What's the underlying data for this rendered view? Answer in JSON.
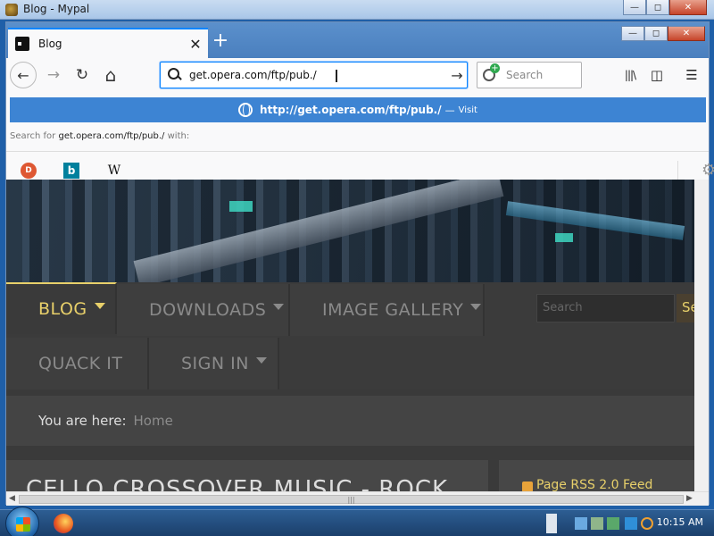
{
  "window": {
    "title": "Blog - Mypal",
    "minimize": "—",
    "maximize": "◻",
    "close": "✕"
  },
  "tab": {
    "title": "Blog",
    "close": "✕",
    "new": "+"
  },
  "nav": {
    "back": "←",
    "forward": "→",
    "reload": "↻",
    "home": "⌂",
    "url": "get.opera.com/ftp/pub./",
    "go": "→",
    "search_placeholder": "Search",
    "library": "|||\\",
    "sidebar": "◫",
    "menu": "☰"
  },
  "dropdown": {
    "suggest_url": "http://get.opera.com/ftp/pub./",
    "suggest_sep": "—",
    "suggest_action": "Visit",
    "search_for_prefix": "Search for",
    "search_for_query": "get.opera.com/ftp/pub./",
    "search_for_suffix": "with:",
    "engines": [
      {
        "name": "duckduckgo-icon",
        "glyph": "D"
      },
      {
        "name": "bing-icon",
        "glyph": "b"
      },
      {
        "name": "wikipedia-icon",
        "glyph": "W"
      }
    ],
    "settings": "⚙"
  },
  "site": {
    "menu": [
      {
        "label": "BLOG",
        "active": true,
        "caret": true
      },
      {
        "label": "DOWNLOADS",
        "active": false,
        "caret": true
      },
      {
        "label": "IMAGE GALLERY",
        "active": false,
        "caret": true
      },
      {
        "label": "QUACK IT",
        "active": false,
        "caret": false
      },
      {
        "label": "SIGN IN",
        "active": false,
        "caret": true
      }
    ],
    "search_placeholder": "Search",
    "search_button": "Se",
    "breadcrumb_label": "You are here:",
    "breadcrumb_home": "Home",
    "article_title": "CELLO CROSSOVER MUSIC - ROCK",
    "rss_text": "Page RSS 2.0 Feed"
  },
  "scroll": {
    "left": "◀",
    "right": "▶",
    "grip": "|||"
  },
  "taskbar": {
    "clock": "10:15 AM"
  },
  "colors": {
    "accent": "#0a84ff",
    "suggest_bg": "#3d84d3",
    "site_accent": "#e8d06a",
    "site_bg": "#3b3b3b"
  }
}
